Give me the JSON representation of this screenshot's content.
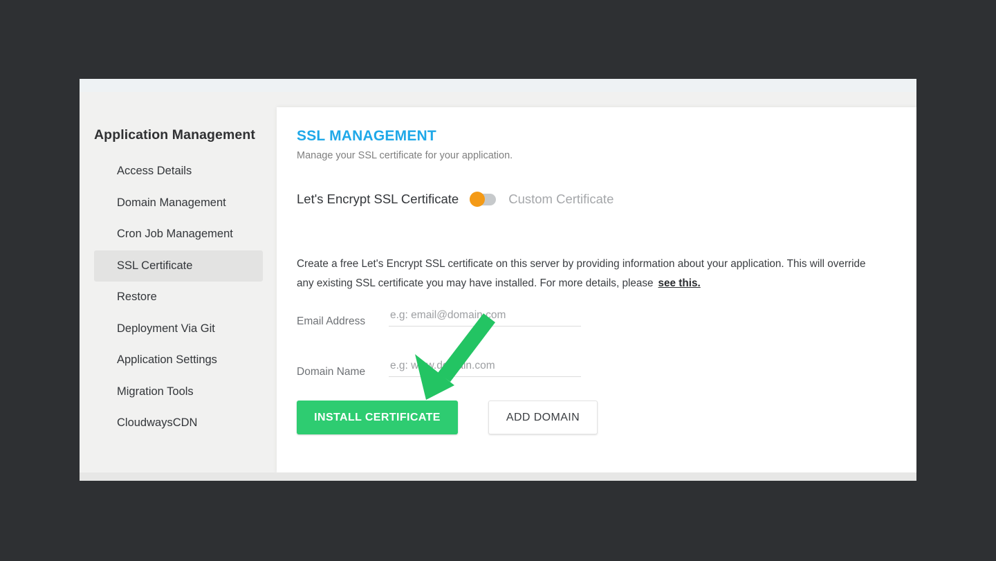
{
  "sidebar": {
    "title": "Application Management",
    "items": [
      {
        "label": "Access Details",
        "active": false
      },
      {
        "label": "Domain Management",
        "active": false
      },
      {
        "label": "Cron Job Management",
        "active": false
      },
      {
        "label": "SSL Certificate",
        "active": true
      },
      {
        "label": "Restore",
        "active": false
      },
      {
        "label": "Deployment Via Git",
        "active": false
      },
      {
        "label": "Application Settings",
        "active": false
      },
      {
        "label": "Migration Tools",
        "active": false
      },
      {
        "label": "CloudwaysCDN",
        "active": false
      }
    ]
  },
  "main": {
    "title": "SSL MANAGEMENT",
    "subtitle": "Manage your SSL certificate for your application.",
    "toggle": {
      "left_label": "Let's Encrypt SSL Certificate",
      "right_label": "Custom Certificate",
      "state": "left",
      "knob_color": "#f49a16",
      "track_color": "#c6c9cb"
    },
    "description": "Create a free Let's Encrypt SSL certificate on this server by providing information about your application. This will override any existing SSL certificate you may have installed. For more details, please",
    "description_link": "see this.",
    "fields": [
      {
        "label": "Email Address",
        "value": "",
        "placeholder": "e.g: email@domain.com"
      },
      {
        "label": "Domain Name",
        "value": "",
        "placeholder": "e.g: www.domain.com"
      }
    ],
    "buttons": {
      "primary": "INSTALL CERTIFICATE",
      "secondary": "ADD DOMAIN"
    }
  },
  "annotation": {
    "arrow_color": "#23C463",
    "points_to": "INSTALL CERTIFICATE"
  },
  "colors": {
    "page_background": "#2e3033",
    "panel_background": "#f1f1f0",
    "card_background": "#ffffff",
    "title_accent": "#1fa8e8",
    "primary_button": "#2ECC71"
  }
}
